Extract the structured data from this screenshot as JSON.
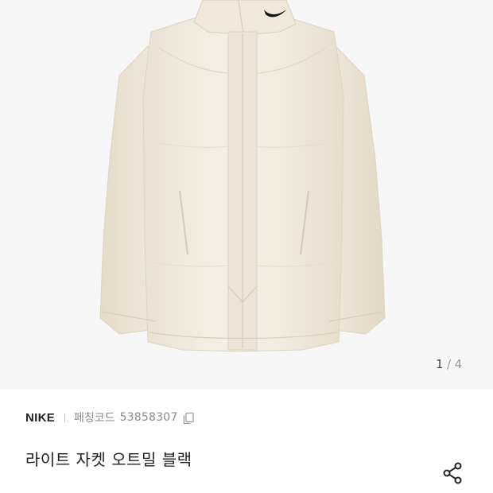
{
  "gallery": {
    "current": "1",
    "separator": "/",
    "total": "4",
    "image_subject": "jacket-photo"
  },
  "product": {
    "brand": "NIKE",
    "code_label": "페칭코드",
    "code_value": "53858307",
    "title": "라이트 자켓 오트밀 블랙"
  },
  "icons": {
    "copy": "copy-icon",
    "share": "share-icon",
    "logo": "swoosh-logo"
  },
  "colors": {
    "jacket": "#f1ebdf",
    "background": "#f7f7f7",
    "brand_text": "#222222",
    "muted_text": "#8a8a8a"
  }
}
